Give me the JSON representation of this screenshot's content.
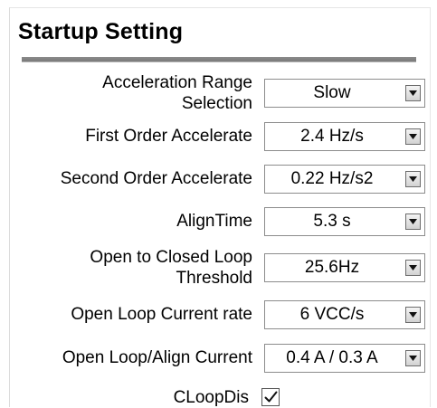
{
  "panel": {
    "title": "Startup Setting"
  },
  "settings": [
    {
      "label_line1": "Acceleration Range",
      "label_line2": "Selection",
      "value": "Slow",
      "arrow_icon": "dropdown-arrow-icon"
    },
    {
      "label_line1": "First Order Accelerate",
      "label_line2": "",
      "value": "2.4 Hz/s",
      "arrow_icon": "dropdown-arrow-icon"
    },
    {
      "label_line1": "Second Order Accelerate",
      "label_line2": "",
      "value": "0.22 Hz/s2",
      "arrow_icon": "dropdown-arrow-icon"
    },
    {
      "label_line1": "AlignTime",
      "label_line2": "",
      "value": "5.3 s",
      "arrow_icon": "dropdown-arrow-icon"
    },
    {
      "label_line1": "Open to Closed Loop",
      "label_line2": "Threshold",
      "value": "25.6Hz",
      "arrow_icon": "dropdown-arrow-icon"
    },
    {
      "label_line1": "Open Loop Current rate",
      "label_line2": "",
      "value": "6 VCC/s",
      "arrow_icon": "dropdown-arrow-icon"
    },
    {
      "label_line1": "Open Loop/Align Current",
      "label_line2": "",
      "value": "0.4 A / 0.3 A",
      "arrow_icon": "dropdown-arrow-icon"
    }
  ],
  "cloop": {
    "label": "CLoopDis",
    "checked": true,
    "icon": "checkmark-icon"
  }
}
